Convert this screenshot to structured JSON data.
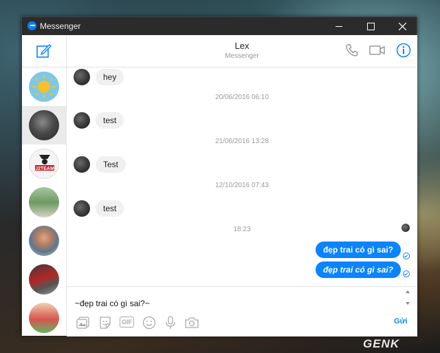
{
  "window": {
    "title": "Messenger"
  },
  "header": {
    "contact_name": "Lex",
    "contact_subtitle": "Messenger"
  },
  "icons": {
    "app": "messenger-icon",
    "compose": "compose-icon",
    "call": "phone-icon",
    "video": "video-camera-icon",
    "info": "info-icon",
    "photos": "photo-icon",
    "sticker": "sticker-icon",
    "gif": "gif-icon",
    "emoji": "emoji-icon",
    "voice": "microphone-icon",
    "camera": "camera-icon"
  },
  "messages": [
    {
      "type": "incoming",
      "text": "hey"
    },
    {
      "type": "timestamp",
      "text": "20/06/2016 06:10"
    },
    {
      "type": "incoming",
      "text": "test"
    },
    {
      "type": "timestamp",
      "text": "21/06/2016 13:28"
    },
    {
      "type": "incoming",
      "text": "Test"
    },
    {
      "type": "timestamp",
      "text": "12/10/2016 07:43"
    },
    {
      "type": "incoming",
      "text": "test"
    },
    {
      "type": "timestamp",
      "text": "18:23"
    },
    {
      "type": "outgoing",
      "text": "đẹp trai có gì sai?"
    },
    {
      "type": "outgoing",
      "text": "đẹp trai có gì sai?"
    }
  ],
  "composer": {
    "draft": "~đẹp trai có gì sai?~",
    "send_label": "Gửi",
    "gif_label": "GIF"
  },
  "sidebar": {
    "contacts": [
      {
        "avatar": "sun-avatar"
      },
      {
        "avatar": "lex-avatar",
        "selected": true
      },
      {
        "avatar": "j2team-avatar",
        "caption": "J2TEAM"
      },
      {
        "avatar": "person-avatar"
      },
      {
        "avatar": "person-avatar"
      },
      {
        "avatar": "group-avatar"
      },
      {
        "avatar": "person-avatar"
      }
    ]
  },
  "watermark": "GENK",
  "colors": {
    "accent": "#0a84ff",
    "titlebar": "#2b2b2b",
    "incoming_bubble": "#f1f0f0"
  }
}
